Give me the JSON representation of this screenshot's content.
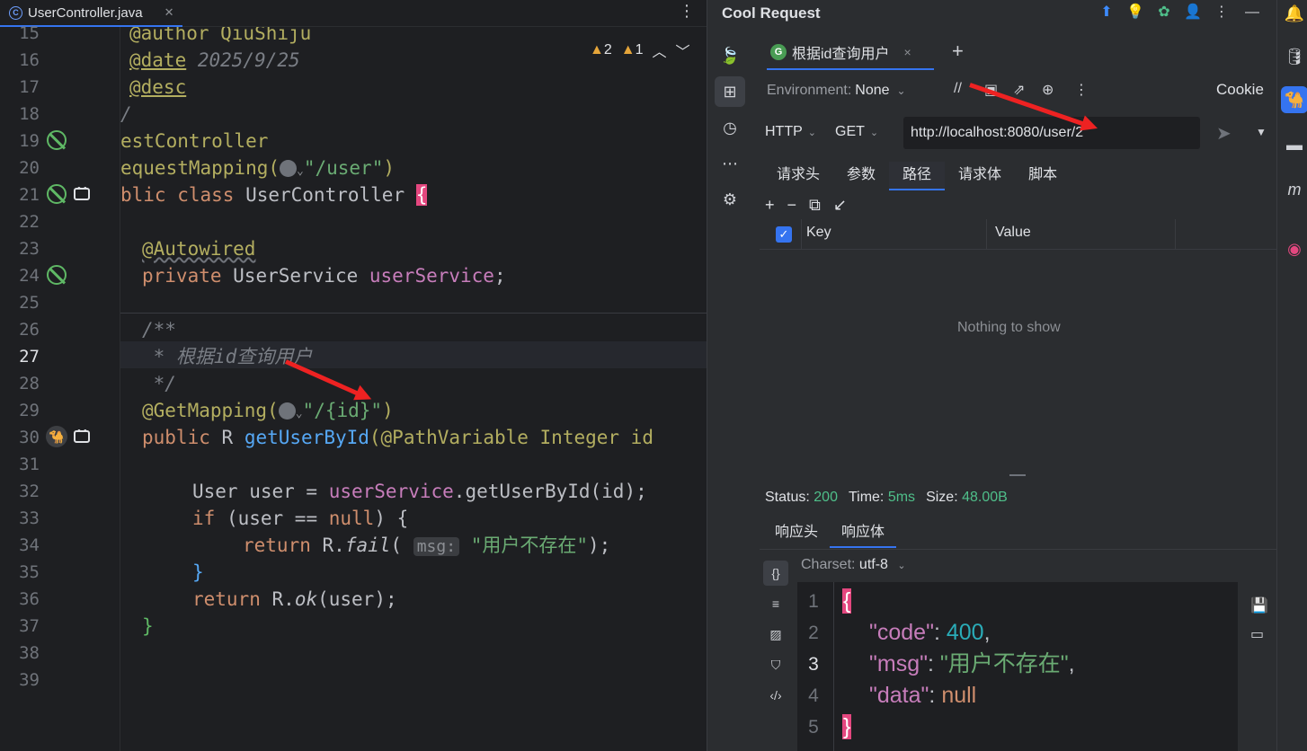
{
  "editor": {
    "file_tab": "UserController.java",
    "menu_glyph": "⋮",
    "warnings": {
      "a": "2",
      "b": "1"
    },
    "line_numbers": [
      "15",
      "16",
      "17",
      "18",
      "19",
      "20",
      "21",
      "22",
      "23",
      "24",
      "25",
      "26",
      "27",
      "28",
      "29",
      "30",
      "31",
      "32",
      "33",
      "34",
      "35",
      "36",
      "37",
      "38",
      "39"
    ],
    "lines": {
      "l15": "@author QiuShiju",
      "l16a": "@date",
      "l16b": " 2025/9/25",
      "l17": "@desc",
      "l18": "/",
      "l19": "estController",
      "l20a": "equestMapping(",
      "l20b": "\"/user\"",
      "l20c": ")",
      "l21a": "blic class ",
      "l21b": "UserController ",
      "l21c": "{",
      "l23": "@Autowired",
      "l24a": "private ",
      "l24b": "UserService ",
      "l24c": "userService",
      "l24d": ";",
      "l26": "/**",
      "l27": " * 根据id查询用户",
      "l28": " */",
      "l29a": "@GetMapping(",
      "l29b": "\"/{id}\"",
      "l29c": ")",
      "l30a": "public ",
      "l30b": "R ",
      "l30c": "getUserById",
      "l30d": "(@PathVariable Integer id",
      "l32a": "User user = ",
      "l32b": "userService",
      "l32c": ".getUserById(id);",
      "l33a": "if ",
      "l33b": "(user == ",
      "l33c": "null",
      "l33d": ") {",
      "l34a": "return ",
      "l34b": "R.",
      "l34c": "fail",
      "l34d": "( ",
      "l34hint": "msg:",
      "l34e": " \"用户不存在\"",
      "l34f": ");",
      "l35": "}",
      "l36a": "return ",
      "l36b": "R.",
      "l36c": "ok",
      "l36d": "(user);",
      "l37": "}"
    }
  },
  "panel": {
    "title": "Cool Request",
    "request_tab": {
      "icon_letter": "G",
      "label": "根据id查询用户",
      "close": "×"
    },
    "add_tab": "+",
    "environment": {
      "label": "Environment:",
      "value": "None"
    },
    "cookie": "Cookie",
    "protocol": "HTTP",
    "method": "GET",
    "url": "http://localhost:8080/user/2",
    "req_tabs": [
      "请求头",
      "参数",
      "路径",
      "请求体",
      "脚本"
    ],
    "table": {
      "col_key": "Key",
      "col_value": "Value",
      "empty": "Nothing to show"
    },
    "status": {
      "status_label": "Status:",
      "status_value": "200",
      "time_label": "Time:",
      "time_value": "5ms",
      "size_label": "Size:",
      "size_value": "48.00B"
    },
    "resp_tabs": [
      "响应头",
      "响应体"
    ],
    "charset": {
      "label": "Charset:",
      "value": "utf-8"
    },
    "json_lines": [
      "1",
      "2",
      "3",
      "4",
      "5"
    ],
    "json": {
      "open": "{",
      "code_key": "\"code\"",
      "code_val": "400",
      "msg_key": "\"msg\"",
      "msg_val": "\"用户不存在\"",
      "data_key": "\"data\"",
      "data_val": "null",
      "close": "}"
    }
  },
  "colors": {
    "accent": "#3574f0",
    "status_ok": "#4fbf8a",
    "arrow": "#ee2222"
  }
}
